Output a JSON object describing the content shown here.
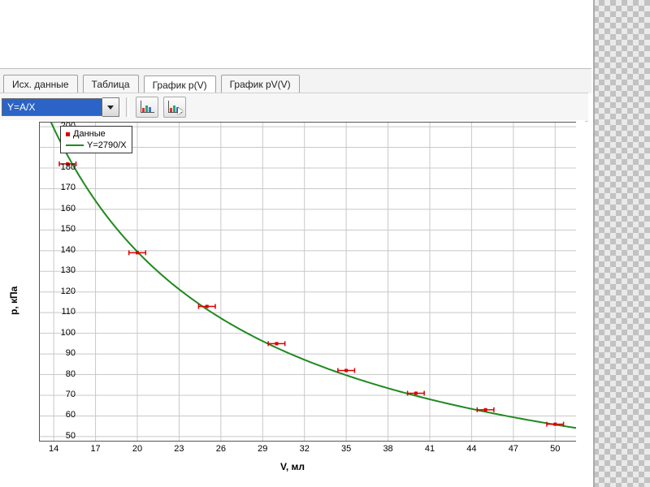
{
  "tabs": {
    "items": [
      {
        "label": "Исх. данные"
      },
      {
        "label": "Таблица"
      },
      {
        "label": "График p(V)",
        "active": true
      },
      {
        "label": "График pV(V)"
      }
    ]
  },
  "toolbar": {
    "fit_combo_value": "Y=A/X",
    "btn_table": "chart-settings-icon",
    "btn_cursor": "chart-cursor-icon"
  },
  "legend": {
    "data_label": "Данные",
    "fit_label": "Y=2790/X"
  },
  "axes": {
    "ylabel": "p, кПа",
    "xlabel": "V, мл"
  },
  "chart_data": {
    "type": "scatter",
    "title": "",
    "xlabel": "V, мл",
    "ylabel": "p, кПа",
    "xlim": [
      13,
      51.5
    ],
    "ylim": [
      48,
      202
    ],
    "x_ticks": [
      14,
      17,
      20,
      23,
      26,
      29,
      32,
      35,
      38,
      41,
      44,
      47,
      50
    ],
    "y_ticks": [
      50,
      60,
      70,
      80,
      90,
      100,
      110,
      120,
      130,
      140,
      150,
      160,
      170,
      180,
      190,
      200
    ],
    "series": [
      {
        "name": "Данные",
        "type": "scatter",
        "x": [
          15,
          20,
          25,
          30,
          35,
          40,
          45,
          50
        ],
        "y": [
          182,
          139,
          113,
          95,
          82,
          71,
          63,
          56
        ],
        "x_err": 0.6
      },
      {
        "name": "Y=2790/X",
        "type": "line",
        "formula": "2790/x",
        "A": 2790
      }
    ]
  }
}
